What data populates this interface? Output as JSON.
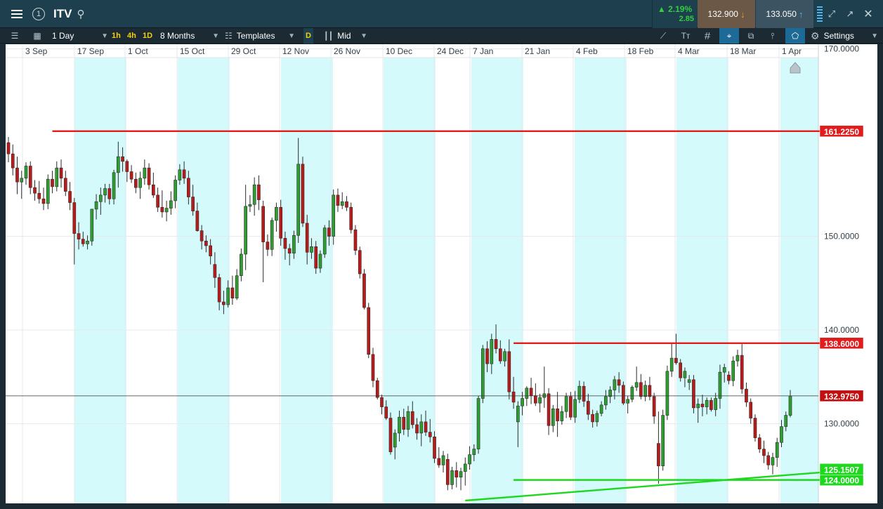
{
  "header": {
    "symbol": "ITV",
    "alert_glyph": "1",
    "change_pct": "▲ 2.19%",
    "change_abs": "2.85",
    "sell_price": "132.900",
    "buy_price": "133.050",
    "icons": [
      "menu-icon",
      "alert-icon",
      "search-icon",
      "tick-down-icon",
      "tick-up-icon",
      "depth-icon",
      "expand-icon",
      "popout-icon",
      "close-icon"
    ]
  },
  "toolbar": {
    "interval": "1 Day",
    "quick_1h": "1h",
    "quick_4h": "4h",
    "quick_1d": "1D",
    "range": "8 Months",
    "templates": "Templates",
    "d_badge": "D",
    "price_type": "Mid",
    "settings": "Settings",
    "grid_glyph": "#",
    "text_glyph": "Tт"
  },
  "chart_data": {
    "type": "candlestick",
    "x_labels": [
      "3 Sep",
      "17 Sep",
      "1 Oct",
      "15 Oct",
      "29 Oct",
      "12 Nov",
      "26 Nov",
      "10 Dec",
      "24 Dec",
      "7 Jan",
      "21 Jan",
      "4 Feb",
      "18 Feb",
      "4 Mar",
      "18 Mar",
      "1 Apr"
    ],
    "y_ticks": [
      "170.0000",
      "150.0000",
      "140.0000",
      "130.0000",
      "124.0000"
    ],
    "ylim": [
      121.5,
      170.5
    ],
    "grid": true,
    "colors": {
      "up": "#2e9e31",
      "down": "#bb1a1a",
      "week_shade": "#d4fafb",
      "resistance": "#e01c1c",
      "support": "#1ed81e",
      "current_price": "#c20e0e"
    },
    "horizontal_lines": [
      {
        "label": "161.2250",
        "value": 161.225,
        "style": "resistance"
      },
      {
        "label": "138.6000",
        "value": 138.6,
        "style": "resistance"
      },
      {
        "label": "124.0000",
        "value": 124.0,
        "style": "support"
      }
    ],
    "trend_line": {
      "label": "125.1507",
      "from_date": "26 Dec",
      "from_value": 121.8,
      "to_value": 125.1507
    },
    "last_price": {
      "label": "132.9750",
      "value": 132.975
    },
    "candles": [
      [
        160.0,
        160.6,
        157.9,
        158.8
      ],
      [
        158.8,
        159.8,
        156.5,
        157.3
      ],
      [
        157.3,
        158.5,
        154.5,
        155.8
      ],
      [
        155.8,
        157.0,
        154.0,
        156.2
      ],
      [
        156.2,
        157.9,
        155.5,
        157.5
      ],
      [
        157.5,
        158.0,
        154.5,
        155.2
      ],
      [
        155.2,
        156.0,
        153.8,
        154.6
      ],
      [
        154.6,
        155.9,
        153.5,
        154.0
      ],
      [
        154.0,
        155.2,
        152.8,
        153.5
      ],
      [
        153.5,
        156.6,
        152.9,
        156.1
      ],
      [
        156.1,
        157.0,
        154.6,
        155.3
      ],
      [
        155.3,
        158.0,
        154.8,
        157.3
      ],
      [
        157.3,
        158.2,
        155.2,
        156.2
      ],
      [
        156.2,
        157.0,
        154.3,
        154.8
      ],
      [
        154.8,
        155.8,
        152.8,
        153.6
      ],
      [
        153.6,
        154.1,
        147.0,
        150.3
      ],
      [
        150.3,
        151.5,
        148.6,
        149.7
      ],
      [
        149.7,
        150.5,
        148.9,
        149.2
      ],
      [
        149.2,
        150.1,
        148.6,
        149.5
      ],
      [
        149.5,
        152.9,
        149.0,
        152.9
      ],
      [
        152.9,
        154.5,
        151.8,
        153.7
      ],
      [
        153.7,
        155.2,
        152.3,
        154.4
      ],
      [
        154.4,
        155.6,
        153.6,
        155.1
      ],
      [
        155.1,
        155.6,
        153.4,
        154.0
      ],
      [
        154.0,
        157.1,
        153.4,
        156.8
      ],
      [
        156.8,
        160.1,
        155.2,
        158.5
      ],
      [
        158.5,
        159.5,
        156.9,
        158.0
      ],
      [
        158.0,
        158.2,
        155.8,
        156.9
      ],
      [
        156.9,
        157.6,
        155.7,
        156.1
      ],
      [
        156.1,
        156.8,
        154.6,
        155.2
      ],
      [
        155.2,
        156.9,
        154.0,
        156.2
      ],
      [
        156.2,
        158.2,
        155.5,
        157.3
      ],
      [
        157.3,
        157.8,
        155.0,
        155.5
      ],
      [
        155.5,
        156.8,
        154.1,
        154.4
      ],
      [
        154.4,
        155.2,
        152.6,
        153.1
      ],
      [
        153.1,
        154.9,
        152.0,
        152.6
      ],
      [
        152.6,
        153.8,
        151.6,
        153.0
      ],
      [
        153.0,
        154.8,
        152.3,
        153.8
      ],
      [
        153.8,
        156.5,
        153.0,
        156.0
      ],
      [
        156.0,
        157.7,
        155.5,
        157.1
      ],
      [
        157.1,
        158.0,
        155.6,
        156.2
      ],
      [
        156.2,
        157.0,
        153.4,
        154.2
      ],
      [
        154.2,
        155.5,
        152.2,
        152.7
      ],
      [
        152.7,
        153.6,
        150.5,
        150.6
      ],
      [
        150.6,
        151.2,
        148.6,
        149.5
      ],
      [
        149.5,
        150.1,
        148.3,
        149.0
      ],
      [
        149.0,
        149.7,
        147.0,
        147.9
      ],
      [
        147.0,
        148.3,
        144.5,
        145.6
      ],
      [
        145.6,
        146.0,
        142.1,
        143.0
      ],
      [
        143.0,
        144.2,
        141.7,
        142.7
      ],
      [
        142.7,
        145.3,
        142.4,
        144.5
      ],
      [
        144.5,
        145.8,
        142.7,
        143.4
      ],
      [
        143.4,
        146.5,
        143.2,
        145.8
      ],
      [
        145.8,
        148.7,
        145.2,
        148.1
      ],
      [
        148.1,
        155.5,
        146.4,
        153.2
      ],
      [
        153.2,
        154.4,
        152.6,
        153.4
      ],
      [
        153.4,
        156.3,
        152.2,
        155.5
      ],
      [
        155.5,
        156.5,
        152.8,
        153.9
      ],
      [
        153.2,
        153.8,
        145.1,
        149.4
      ],
      [
        149.4,
        150.2,
        147.9,
        148.6
      ],
      [
        148.6,
        152.0,
        147.9,
        151.7
      ],
      [
        151.7,
        153.6,
        150.5,
        153.1
      ],
      [
        153.1,
        153.9,
        149.0,
        149.8
      ],
      [
        149.8,
        150.5,
        147.5,
        148.7
      ],
      [
        148.7,
        149.2,
        146.9,
        148.2
      ],
      [
        148.2,
        150.6,
        147.6,
        150.1
      ],
      [
        150.1,
        160.5,
        149.3,
        157.7
      ],
      [
        157.7,
        158.5,
        151.0,
        151.4
      ],
      [
        151.4,
        152.3,
        147.0,
        148.3
      ],
      [
        148.3,
        149.8,
        147.6,
        148.9
      ],
      [
        148.9,
        149.5,
        146.0,
        146.6
      ],
      [
        146.6,
        148.5,
        146.1,
        148.1
      ],
      [
        148.1,
        151.2,
        147.7,
        150.9
      ],
      [
        150.9,
        151.7,
        149.0,
        150.0
      ],
      [
        150.0,
        155.0,
        149.1,
        154.4
      ],
      [
        154.4,
        155.1,
        152.6,
        153.3
      ],
      [
        153.3,
        154.7,
        152.9,
        153.7
      ],
      [
        153.7,
        154.3,
        152.7,
        153.1
      ],
      [
        153.1,
        153.6,
        150.3,
        150.7
      ],
      [
        150.7,
        151.2,
        148.0,
        148.5
      ],
      [
        148.5,
        148.9,
        145.5,
        146.0
      ],
      [
        146.0,
        146.5,
        142.2,
        142.4
      ],
      [
        142.4,
        142.9,
        137.0,
        137.4
      ],
      [
        137.4,
        138.1,
        133.9,
        134.6
      ],
      [
        134.6,
        134.9,
        132.6,
        132.8
      ],
      [
        132.8,
        133.1,
        131.0,
        131.8
      ],
      [
        131.8,
        132.5,
        130.4,
        130.6
      ],
      [
        130.6,
        131.2,
        126.7,
        127.0
      ],
      [
        127.5,
        129.4,
        126.2,
        129.0
      ],
      [
        129.0,
        131.4,
        128.1,
        130.7
      ],
      [
        130.7,
        131.6,
        128.8,
        129.4
      ],
      [
        129.4,
        131.9,
        128.6,
        131.3
      ],
      [
        131.3,
        132.4,
        129.5,
        129.9
      ],
      [
        129.9,
        130.6,
        128.3,
        129.0
      ],
      [
        129.0,
        131.0,
        127.6,
        130.2
      ],
      [
        130.2,
        131.4,
        128.7,
        129.1
      ],
      [
        129.1,
        130.5,
        128.0,
        128.6
      ],
      [
        128.6,
        129.2,
        125.8,
        126.3
      ],
      [
        126.3,
        127.5,
        125.3,
        125.6
      ],
      [
        125.6,
        127.1,
        124.8,
        126.6
      ],
      [
        126.2,
        126.8,
        122.9,
        123.5
      ],
      [
        123.5,
        125.4,
        123.0,
        125.0
      ],
      [
        125.0,
        125.9,
        123.2,
        124.3
      ],
      [
        124.3,
        125.3,
        122.9,
        124.9
      ],
      [
        124.9,
        126.4,
        123.4,
        125.7
      ],
      [
        125.7,
        127.6,
        125.1,
        126.7
      ],
      [
        126.7,
        127.8,
        126.0,
        127.3
      ],
      [
        127.3,
        133.0,
        126.8,
        132.7
      ],
      [
        132.7,
        138.4,
        132.2,
        138.0
      ],
      [
        138.0,
        138.8,
        135.5,
        136.4
      ],
      [
        136.4,
        139.6,
        135.3,
        139.0
      ],
      [
        139.0,
        140.6,
        137.5,
        138.0
      ],
      [
        138.0,
        138.9,
        136.4,
        136.7
      ],
      [
        136.7,
        138.0,
        136.1,
        137.7
      ],
      [
        137.7,
        139.0,
        132.6,
        133.4
      ],
      [
        133.4,
        135.0,
        131.6,
        132.3
      ],
      [
        130.2,
        132.4,
        127.5,
        131.9
      ],
      [
        131.9,
        133.4,
        130.9,
        132.7
      ],
      [
        132.7,
        134.0,
        131.9,
        133.8
      ],
      [
        133.8,
        134.9,
        132.1,
        133.0
      ],
      [
        133.0,
        134.3,
        131.9,
        132.2
      ],
      [
        132.2,
        133.2,
        131.2,
        132.8
      ],
      [
        132.8,
        136.1,
        131.7,
        133.2
      ],
      [
        133.2,
        133.8,
        128.8,
        129.8
      ],
      [
        129.8,
        132.0,
        129.1,
        131.6
      ],
      [
        131.6,
        133.4,
        128.6,
        130.3
      ],
      [
        130.3,
        131.9,
        129.9,
        131.3
      ],
      [
        131.3,
        133.3,
        130.6,
        132.9
      ],
      [
        132.9,
        133.4,
        130.4,
        130.7
      ],
      [
        130.7,
        133.5,
        130.1,
        132.6
      ],
      [
        132.6,
        134.6,
        132.2,
        134.0
      ],
      [
        134.0,
        134.5,
        131.8,
        132.4
      ],
      [
        132.4,
        133.2,
        130.4,
        131.0
      ],
      [
        131.0,
        131.5,
        129.6,
        130.2
      ],
      [
        130.2,
        131.4,
        129.7,
        131.1
      ],
      [
        131.1,
        132.4,
        130.8,
        132.0
      ],
      [
        132.0,
        133.6,
        131.5,
        132.9
      ],
      [
        132.9,
        134.0,
        132.2,
        133.6
      ],
      [
        133.6,
        135.1,
        132.6,
        134.7
      ],
      [
        134.7,
        135.5,
        133.3,
        134.1
      ],
      [
        134.1,
        134.5,
        132.0,
        132.2
      ],
      [
        132.2,
        133.0,
        131.1,
        132.6
      ],
      [
        132.6,
        134.1,
        132.3,
        133.9
      ],
      [
        133.9,
        136.1,
        133.5,
        134.4
      ],
      [
        134.4,
        135.3,
        132.6,
        132.9
      ],
      [
        132.9,
        134.6,
        132.4,
        134.1
      ],
      [
        134.1,
        135.0,
        132.5,
        132.9
      ],
      [
        132.9,
        133.3,
        130.0,
        130.8
      ],
      [
        127.9,
        131.3,
        123.6,
        125.5
      ],
      [
        125.5,
        131.5,
        125.0,
        130.9
      ],
      [
        130.9,
        136.2,
        130.4,
        135.6
      ],
      [
        135.6,
        138.6,
        135.0,
        137.0
      ],
      [
        137.0,
        139.6,
        136.3,
        136.5
      ],
      [
        136.5,
        136.9,
        134.5,
        134.9
      ],
      [
        134.9,
        136.0,
        133.9,
        135.6
      ],
      [
        134.4,
        135.2,
        133.6,
        134.7
      ],
      [
        134.7,
        135.2,
        131.1,
        131.7
      ],
      [
        131.7,
        132.7,
        130.1,
        132.1
      ],
      [
        132.1,
        133.1,
        130.8,
        131.8
      ],
      [
        131.8,
        132.8,
        131.0,
        132.5
      ],
      [
        132.5,
        132.8,
        131.3,
        131.5
      ],
      [
        131.5,
        133.3,
        130.8,
        132.7
      ],
      [
        132.7,
        136.3,
        131.6,
        135.5
      ],
      [
        135.5,
        136.4,
        134.4,
        136.0
      ],
      [
        135.2,
        135.6,
        134.2,
        134.6
      ],
      [
        134.6,
        137.2,
        134.0,
        136.7
      ],
      [
        136.7,
        137.9,
        136.1,
        137.3
      ],
      [
        137.3,
        138.5,
        133.2,
        133.7
      ],
      [
        133.7,
        134.4,
        131.8,
        132.3
      ],
      [
        132.3,
        132.7,
        130.0,
        130.6
      ],
      [
        130.6,
        131.0,
        128.1,
        128.5
      ],
      [
        128.5,
        128.9,
        126.9,
        127.3
      ],
      [
        127.3,
        128.2,
        125.8,
        126.6
      ],
      [
        126.6,
        127.0,
        125.1,
        125.6
      ],
      [
        125.6,
        126.9,
        124.6,
        126.4
      ],
      [
        126.4,
        128.5,
        125.4,
        128.0
      ],
      [
        128.0,
        130.4,
        127.5,
        129.7
      ],
      [
        129.7,
        131.3,
        129.2,
        130.9
      ],
      [
        130.9,
        133.6,
        130.7,
        132.975
      ]
    ]
  }
}
